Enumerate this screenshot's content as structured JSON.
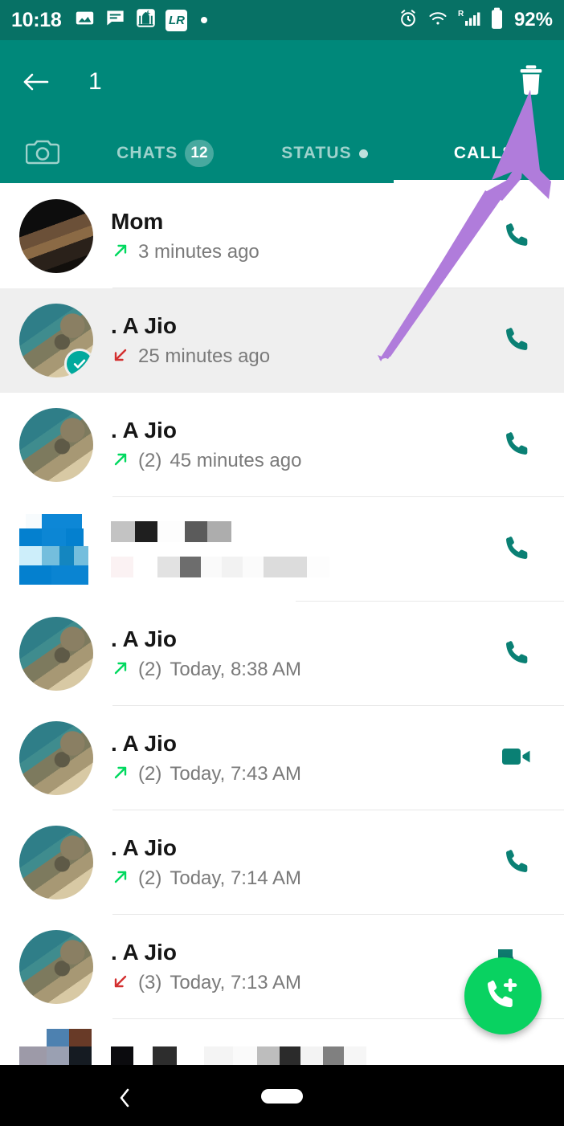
{
  "status_bar": {
    "time": "10:18",
    "left_icons": [
      "image-icon",
      "message-icon",
      "mosque-icon",
      "lr-icon",
      "white-dot"
    ],
    "lr_label": "LR",
    "right_icons": [
      "alarm-icon",
      "wifi-icon",
      "signal-icon",
      "battery-icon"
    ],
    "roaming_label": "R",
    "battery_percent": "92%"
  },
  "toolbar": {
    "back_icon": "arrow-left-icon",
    "selection_count": "1",
    "delete_icon": "trash-icon"
  },
  "tabs": {
    "camera_icon": "camera-icon",
    "items": [
      {
        "label": "CHATS",
        "badge": "12",
        "dot": false,
        "active": false
      },
      {
        "label": "STATUS",
        "badge": "",
        "dot": true,
        "active": false
      },
      {
        "label": "CALLS",
        "badge": "",
        "dot": false,
        "active": true
      }
    ]
  },
  "calls": [
    {
      "name": "Mom",
      "direction": "outgoing",
      "count": "",
      "time": "3 minutes ago",
      "action_icon": "phone-icon",
      "avatar": "dark",
      "selected": false,
      "censored": false
    },
    {
      "name": ". A Jio",
      "direction": "incoming",
      "count": "",
      "time": "25 minutes ago",
      "action_icon": "phone-icon",
      "avatar": "beach",
      "selected": true,
      "censored": false
    },
    {
      "name": ". A Jio",
      "direction": "outgoing",
      "count": "(2)",
      "time": "45 minutes ago",
      "action_icon": "phone-icon",
      "avatar": "beach",
      "selected": false,
      "censored": false
    },
    {
      "name": "",
      "direction": "",
      "count": "",
      "time": "",
      "action_icon": "phone-icon",
      "avatar": "censored-blue",
      "selected": false,
      "censored": true
    },
    {
      "name": ". A Jio",
      "direction": "outgoing",
      "count": "(2)",
      "time": "Today, 8:38 AM",
      "action_icon": "phone-icon",
      "avatar": "beach",
      "selected": false,
      "censored": false
    },
    {
      "name": ". A Jio",
      "direction": "outgoing",
      "count": "(2)",
      "time": "Today, 7:43 AM",
      "action_icon": "video-icon",
      "avatar": "beach",
      "selected": false,
      "censored": false
    },
    {
      "name": ". A Jio",
      "direction": "outgoing",
      "count": "(2)",
      "time": "Today, 7:14 AM",
      "action_icon": "phone-icon",
      "avatar": "beach",
      "selected": false,
      "censored": false
    },
    {
      "name": ". A Jio",
      "direction": "incoming",
      "count": "(3)",
      "time": "Today, 7:13 AM",
      "action_icon": "phone-icon",
      "avatar": "beach",
      "selected": false,
      "censored": false
    }
  ],
  "fab": {
    "icon": "phone-plus-icon"
  },
  "annotation": {
    "type": "arrow",
    "color": "#B07CDB",
    "points_to": "trash-icon"
  },
  "nav_bar": {
    "back_icon": "chevron-left-icon",
    "home_icon": "home-pill-indicator"
  },
  "colors": {
    "status_bar": "#077165",
    "toolbar": "#00887A",
    "accent_green": "#09D261",
    "outgoing_arrow": "#00D95F",
    "incoming_arrow": "#D32F2F",
    "action_icon": "#0A8074",
    "selected_row": "#EFEFEF",
    "check_badge": "#00A99D",
    "annotation_arrow": "#B07CDB"
  }
}
